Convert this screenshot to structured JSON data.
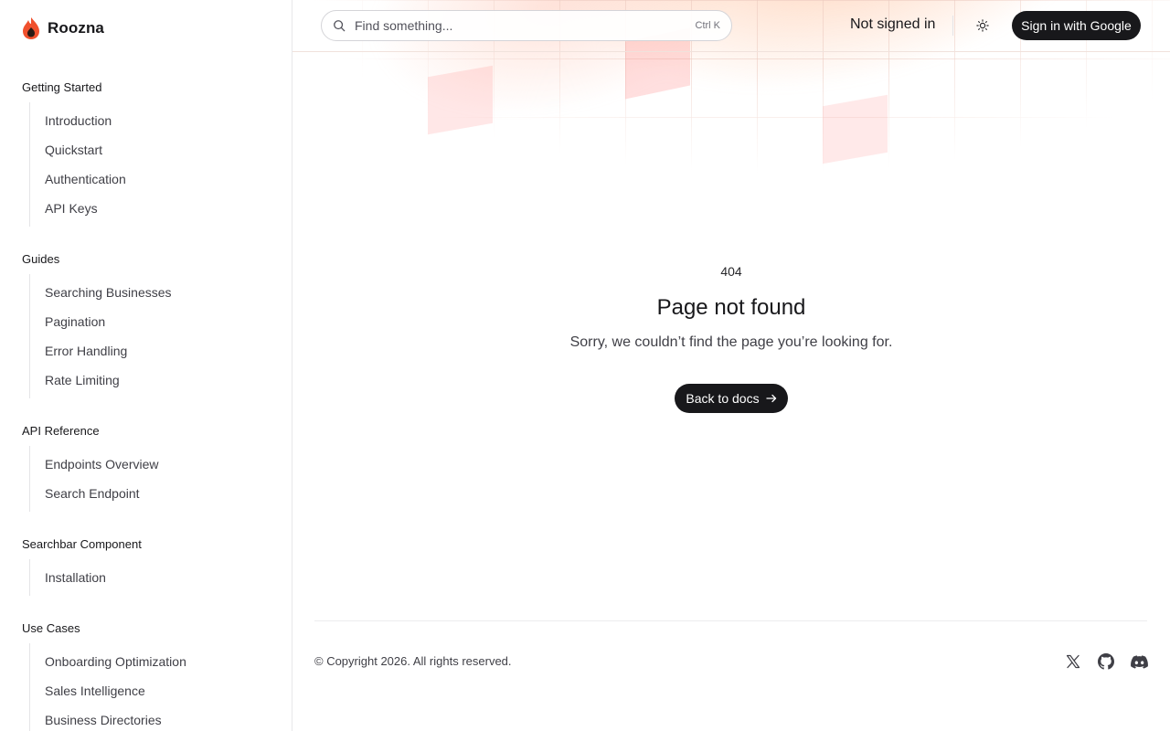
{
  "brand": {
    "name": "Roozna",
    "logo_icon": "flame-logo-icon",
    "accent": "#f0502d"
  },
  "sidebar": {
    "sections": [
      {
        "title": "Getting Started",
        "items": [
          "Introduction",
          "Quickstart",
          "Authentication",
          "API Keys"
        ]
      },
      {
        "title": "Guides",
        "items": [
          "Searching Businesses",
          "Pagination",
          "Error Handling",
          "Rate Limiting"
        ]
      },
      {
        "title": "API Reference",
        "items": [
          "Endpoints Overview",
          "Search Endpoint"
        ]
      },
      {
        "title": "Searchbar Component",
        "items": [
          "Installation"
        ]
      },
      {
        "title": "Use Cases",
        "items": [
          "Onboarding Optimization",
          "Sales Intelligence",
          "Business Directories"
        ]
      }
    ]
  },
  "header": {
    "search": {
      "placeholder": "Find something...",
      "shortcut": "Ctrl K",
      "icon": "search-icon"
    },
    "auth_status": "Not signed in",
    "theme_icon": "sun-icon",
    "signin_label": "Sign in with Google"
  },
  "notfound": {
    "code": "404",
    "title": "Page not found",
    "message": "Sorry, we couldn’t find the page you’re looking for.",
    "back_label": "Back to docs",
    "back_icon": "arrow-right-icon"
  },
  "footer": {
    "copyright": "© Copyright 2026. All rights reserved.",
    "social": [
      "x-icon",
      "github-icon",
      "discord-icon"
    ]
  },
  "colors": {
    "primary_button": "#18181b",
    "glow": "#ffb08a"
  }
}
